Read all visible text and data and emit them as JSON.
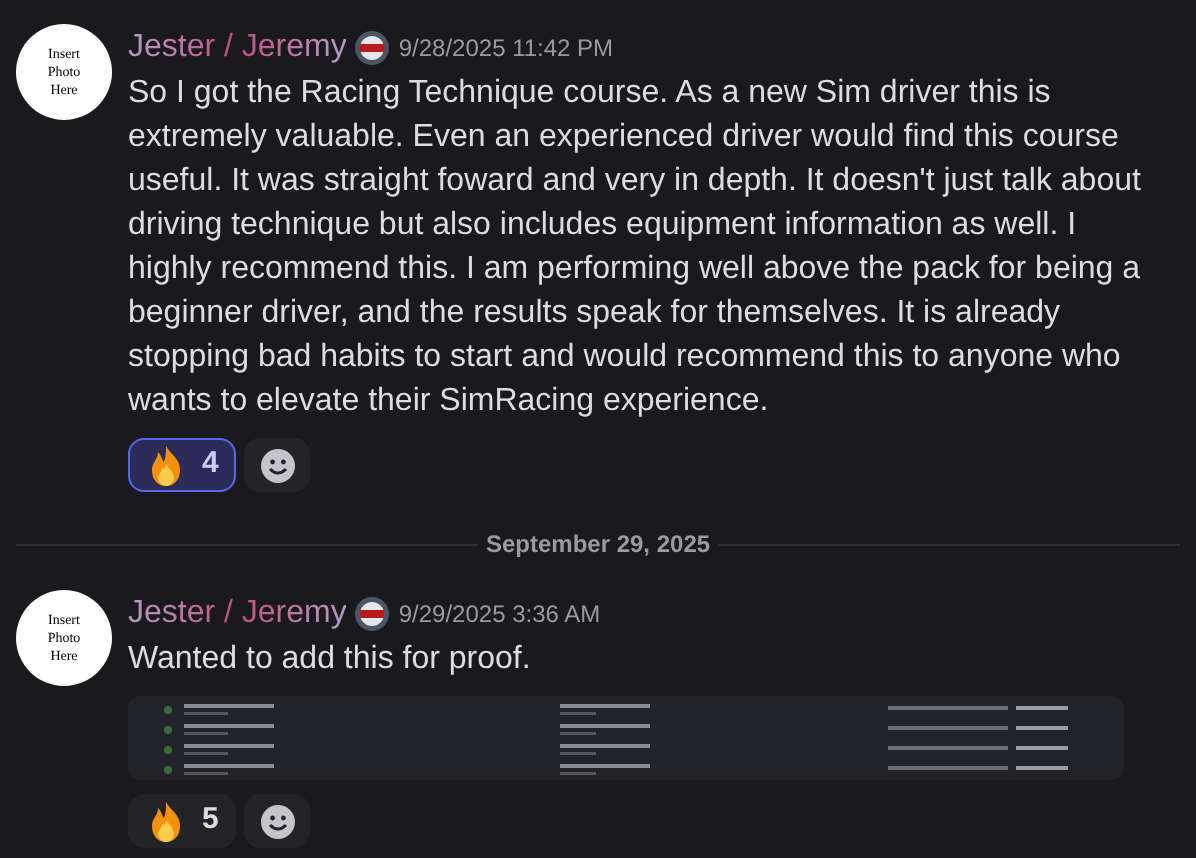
{
  "messages": [
    {
      "avatar_text": "Insert Photo Here",
      "author": "Jester / Jeremy",
      "timestamp": "9/28/2025 11:42 PM",
      "text": "So I got the Racing Technique course. As a new Sim driver this is extremely valuable. Even an experienced driver would find this course useful. It was straight foward and very in depth. It doesn't just talk about driving technique but also includes equipment information as well. I highly recommend this. I am performing well above the pack for being a beginner driver, and the results speak for themselves. It is already stopping bad habits to start and would recommend this to anyone who wants to elevate their SimRacing experience.",
      "reactions": [
        {
          "count": "4",
          "selected": true
        }
      ]
    },
    {
      "avatar_text": "Insert Photo Here",
      "author": "Jester / Jeremy",
      "timestamp": "9/29/2025 3:36 AM",
      "text": "Wanted to add this for proof.",
      "attachment": {
        "kind": "picture"
      },
      "reactions": [
        {
          "count": "5",
          "selected": false
        }
      ]
    }
  ],
  "date_divider": "September 29, 2025"
}
